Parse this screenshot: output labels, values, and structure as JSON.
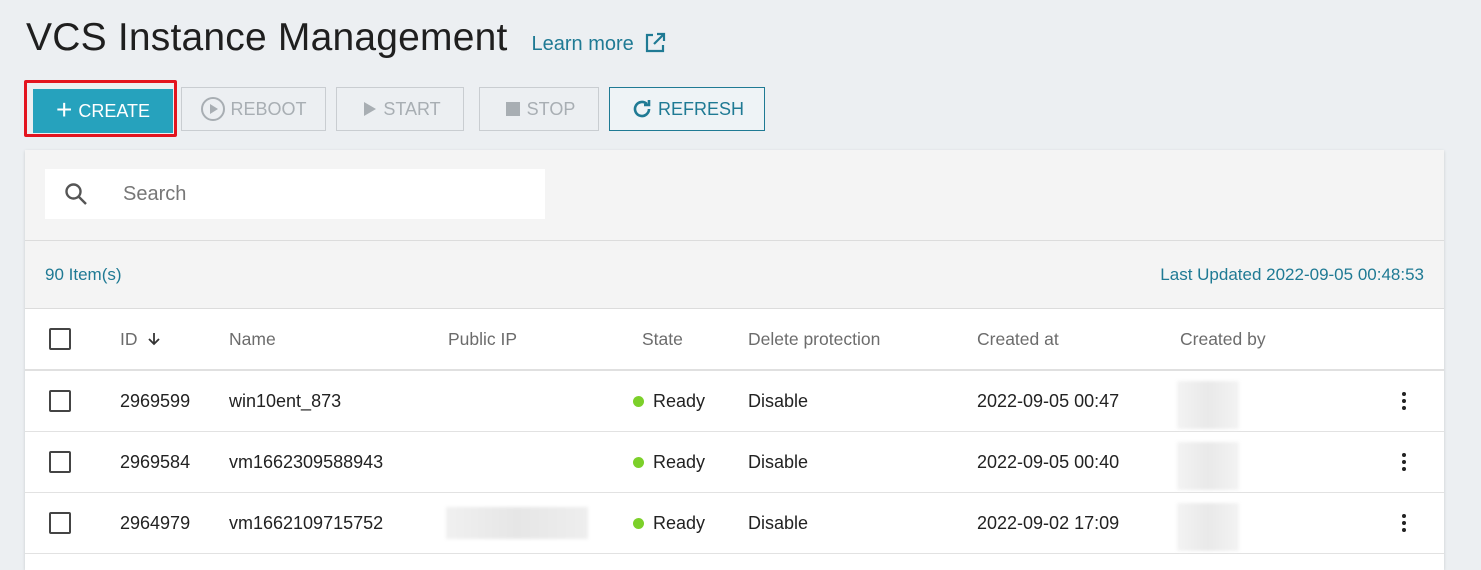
{
  "header": {
    "title": "VCS Instance Management",
    "learn_more": "Learn more"
  },
  "toolbar": {
    "create": "CREATE",
    "reboot": "REBOOT",
    "start": "START",
    "stop": "STOP",
    "refresh": "REFRESH"
  },
  "search": {
    "placeholder": "Search"
  },
  "summary": {
    "count": "90 Item(s)",
    "last_updated": "Last Updated 2022-09-05 00:48:53"
  },
  "table": {
    "columns": {
      "id": "ID",
      "name": "Name",
      "public_ip": "Public IP",
      "state": "State",
      "delete_protection": "Delete protection",
      "created_at": "Created at",
      "created_by": "Created by"
    },
    "rows": [
      {
        "id": "2969599",
        "name": "win10ent_873",
        "state": "Ready",
        "delete_protection": "Disable",
        "created_at": "2022-09-05 00:47"
      },
      {
        "id": "2969584",
        "name": "vm1662309588943",
        "state": "Ready",
        "delete_protection": "Disable",
        "created_at": "2022-09-05 00:40"
      },
      {
        "id": "2964979",
        "name": "vm1662109715752",
        "state": "Ready",
        "delete_protection": "Disable",
        "created_at": "2022-09-02 17:09"
      }
    ]
  },
  "colors": {
    "primary": "#26a2bd",
    "link": "#1f7a94",
    "highlight_border": "#e3141f",
    "ready_dot": "#7cd02a"
  },
  "icons": {
    "create": "plus-icon",
    "reboot": "play-circle-icon",
    "start": "play-icon",
    "stop": "stop-icon",
    "refresh": "refresh-icon",
    "search": "search-icon",
    "external": "external-link-icon",
    "sort": "arrow-down-icon",
    "row_menu": "kebab-menu-icon"
  }
}
